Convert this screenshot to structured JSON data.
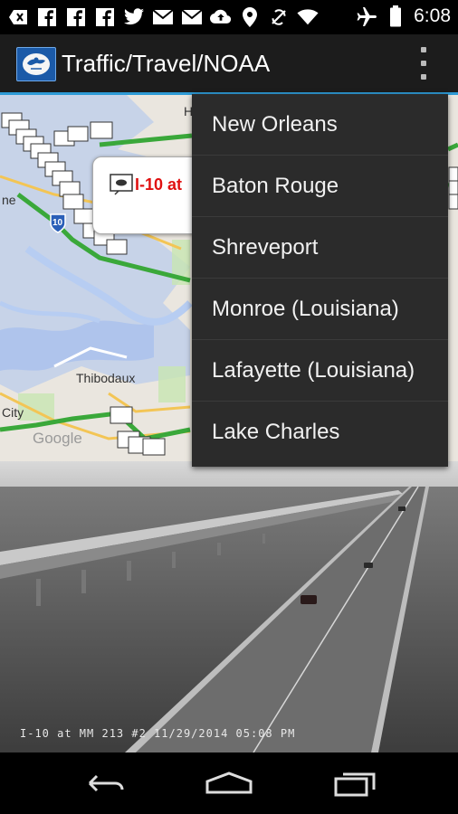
{
  "status_bar": {
    "time": "6:08",
    "icons_left": [
      "back-key-icon",
      "facebook-icon",
      "facebook-icon",
      "facebook-icon",
      "twitter-icon",
      "gmail-icon",
      "gmail-icon",
      "cloud-upload-icon",
      "location-pin-icon",
      "no-sync-icon",
      "wifi-icon"
    ],
    "icons_right": [
      "airplane-icon",
      "battery-icon"
    ]
  },
  "app_bar": {
    "title": "Traffic/Travel/NOAA"
  },
  "map": {
    "labels": {
      "thibodaux": "Thibodaux",
      "city": "City",
      "ne": "ne",
      "google": "Google",
      "h": "H"
    },
    "callout_text": "I-10 at",
    "shield": "10"
  },
  "menu": {
    "items": [
      "New Orleans",
      "Baton Rouge",
      "Shreveport",
      "Monroe (Louisiana)",
      "Lafayette (Louisiana)",
      "Lake Charles"
    ]
  },
  "camera": {
    "caption": "I-10 at MM 213 #2 11/29/2014 05:08 PM"
  },
  "colors": {
    "accent": "#2e9bd6",
    "menu_bg": "#2b2b2b",
    "highway_green": "#3aa83a",
    "callout_red": "#e01010"
  }
}
